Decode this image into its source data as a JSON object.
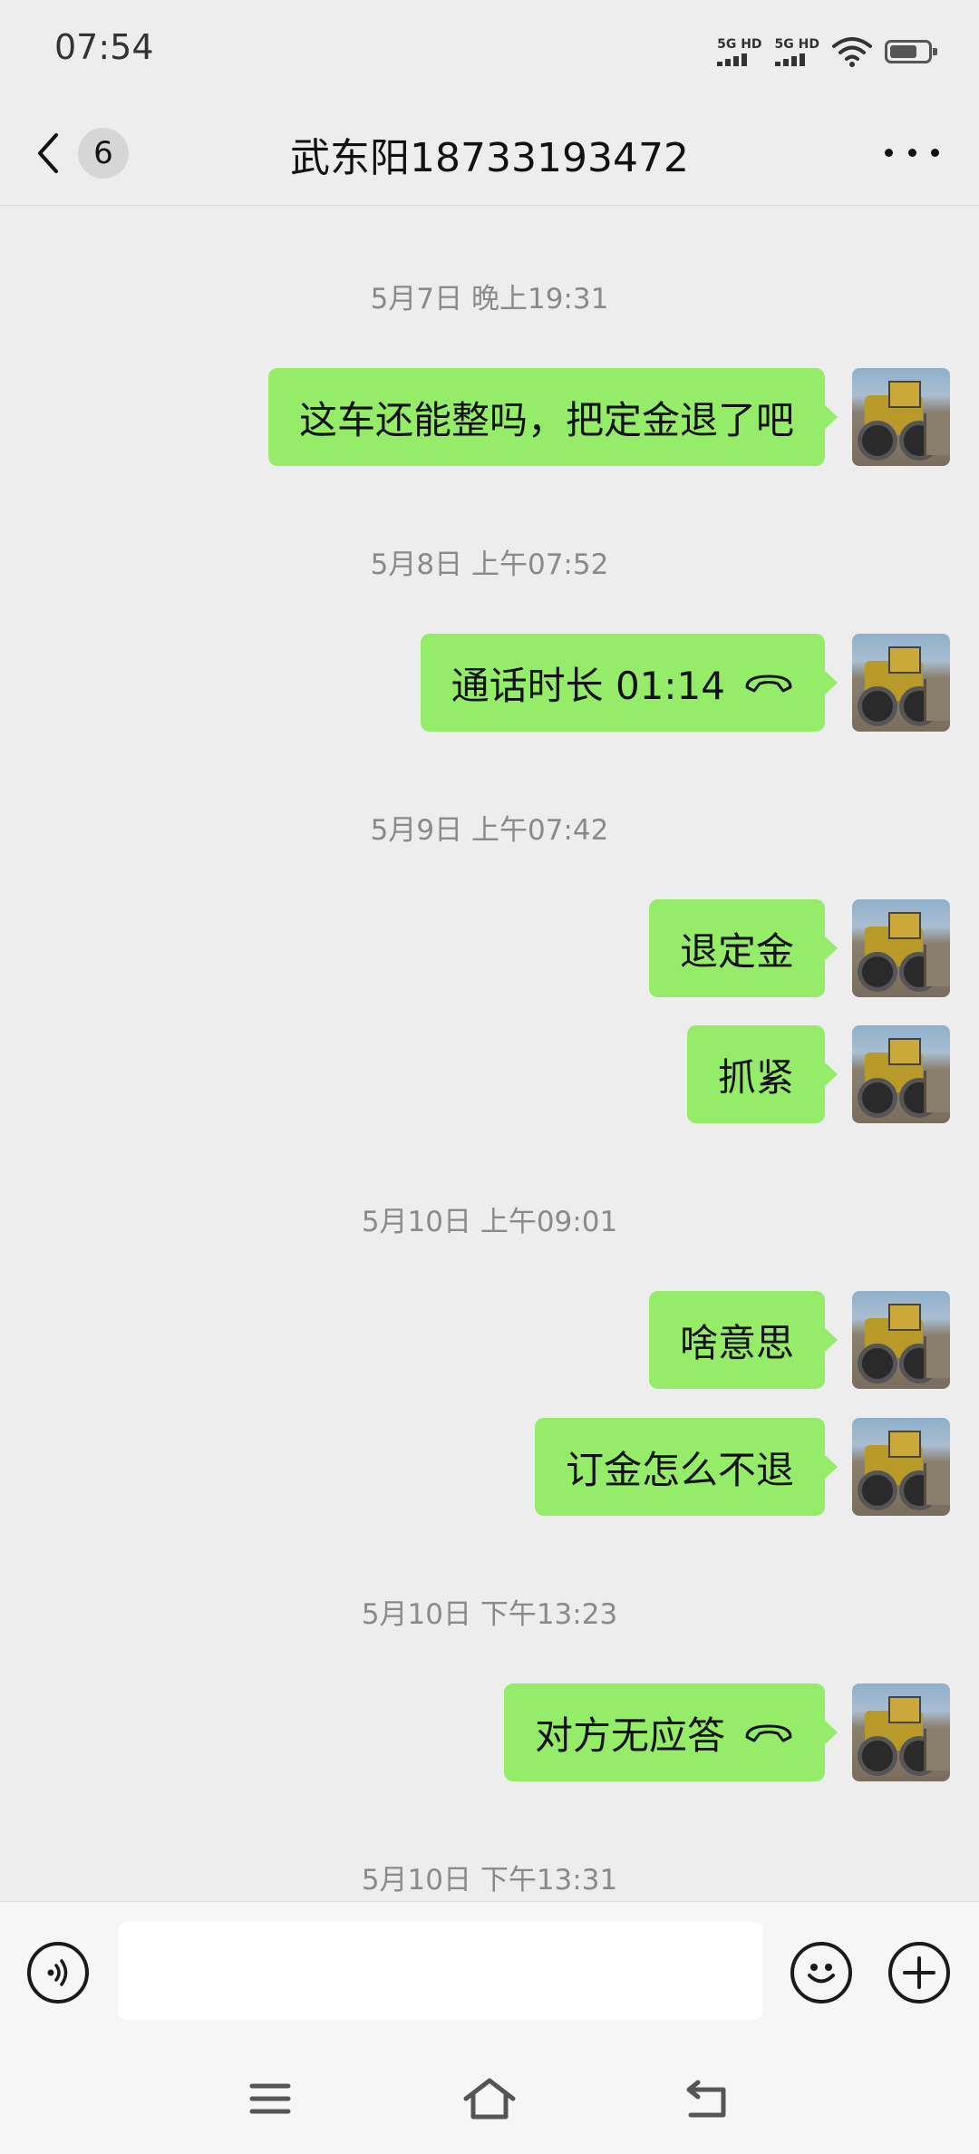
{
  "status_bar": {
    "time": "07:54",
    "sim1_label": "5G HD",
    "sim2_label": "5G HD",
    "icons": [
      "signal-icon",
      "signal-icon",
      "wifi-icon",
      "battery-icon"
    ]
  },
  "header": {
    "back_icon": "chevron-left-icon",
    "unread_count": "6",
    "title": "武东阳18733193472",
    "more_icon": "more-dots-icon"
  },
  "messages": [
    {
      "type": "timestamp",
      "text": "5月7日 晚上19:31"
    },
    {
      "type": "text",
      "side": "right",
      "text": "这车还能整吗，把定金退了吧"
    },
    {
      "type": "timestamp",
      "text": "5月8日 上午07:52"
    },
    {
      "type": "call",
      "side": "right",
      "text": "通话时长 01:14",
      "icon": "phone-hangup-icon"
    },
    {
      "type": "timestamp",
      "text": "5月9日 上午07:42"
    },
    {
      "type": "text",
      "side": "right",
      "text": "退定金"
    },
    {
      "type": "text",
      "side": "right",
      "text": "抓紧"
    },
    {
      "type": "timestamp",
      "text": "5月10日 上午09:01"
    },
    {
      "type": "text",
      "side": "right",
      "text": "啥意思"
    },
    {
      "type": "text",
      "side": "right",
      "text": "订金怎么不退"
    },
    {
      "type": "timestamp",
      "text": "5月10日 下午13:23"
    },
    {
      "type": "call",
      "side": "right",
      "text": "对方无应答",
      "icon": "phone-hangup-icon"
    },
    {
      "type": "timestamp",
      "text": "5月10日 下午13:31"
    }
  ],
  "input_bar": {
    "voice_icon": "voice-icon",
    "text_value": "",
    "emoji_icon": "emoji-icon",
    "plus_icon": "plus-icon"
  },
  "nav_bar": {
    "icons": [
      "menu-icon",
      "home-icon",
      "back-icon"
    ]
  },
  "colors": {
    "background": "#ededed",
    "bubble_green": "#95ec69",
    "timestamp_gray": "#8a8a8a"
  }
}
